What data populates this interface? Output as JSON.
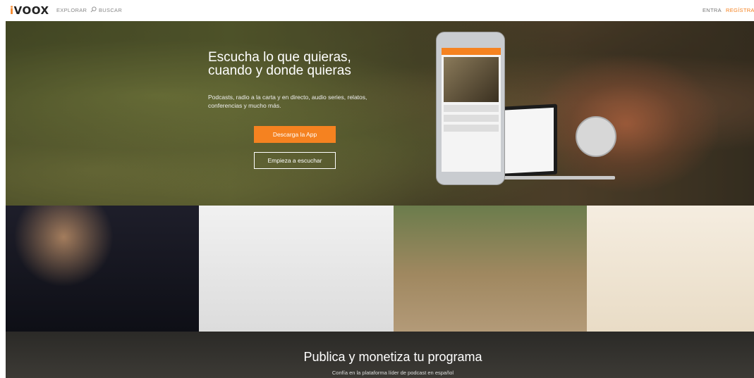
{
  "header": {
    "logo_prefix": "i",
    "logo_rest": "VOOX",
    "explorar": "EXPLORAR",
    "buscar": "BUSCAR",
    "entra": "ENTRA",
    "registrate": "REGÍSTRATE"
  },
  "hero": {
    "title_line1": "Escucha lo que quieras,",
    "title_line2": "cuando y donde quieras",
    "subtitle_line1": "Podcasts, radio a la carta y en directo, audio series, relatos,",
    "subtitle_line2": "conferencias y mucho más.",
    "download_button": "Descarga la App",
    "listen_button": "Empieza a escuchar"
  },
  "promo": {
    "title": "Publica y monetiza tu programa",
    "subtitle": "Confía en la plataforma líder de podcast en español"
  },
  "colors": {
    "accent": "#f58220",
    "nav_text": "#888888"
  }
}
